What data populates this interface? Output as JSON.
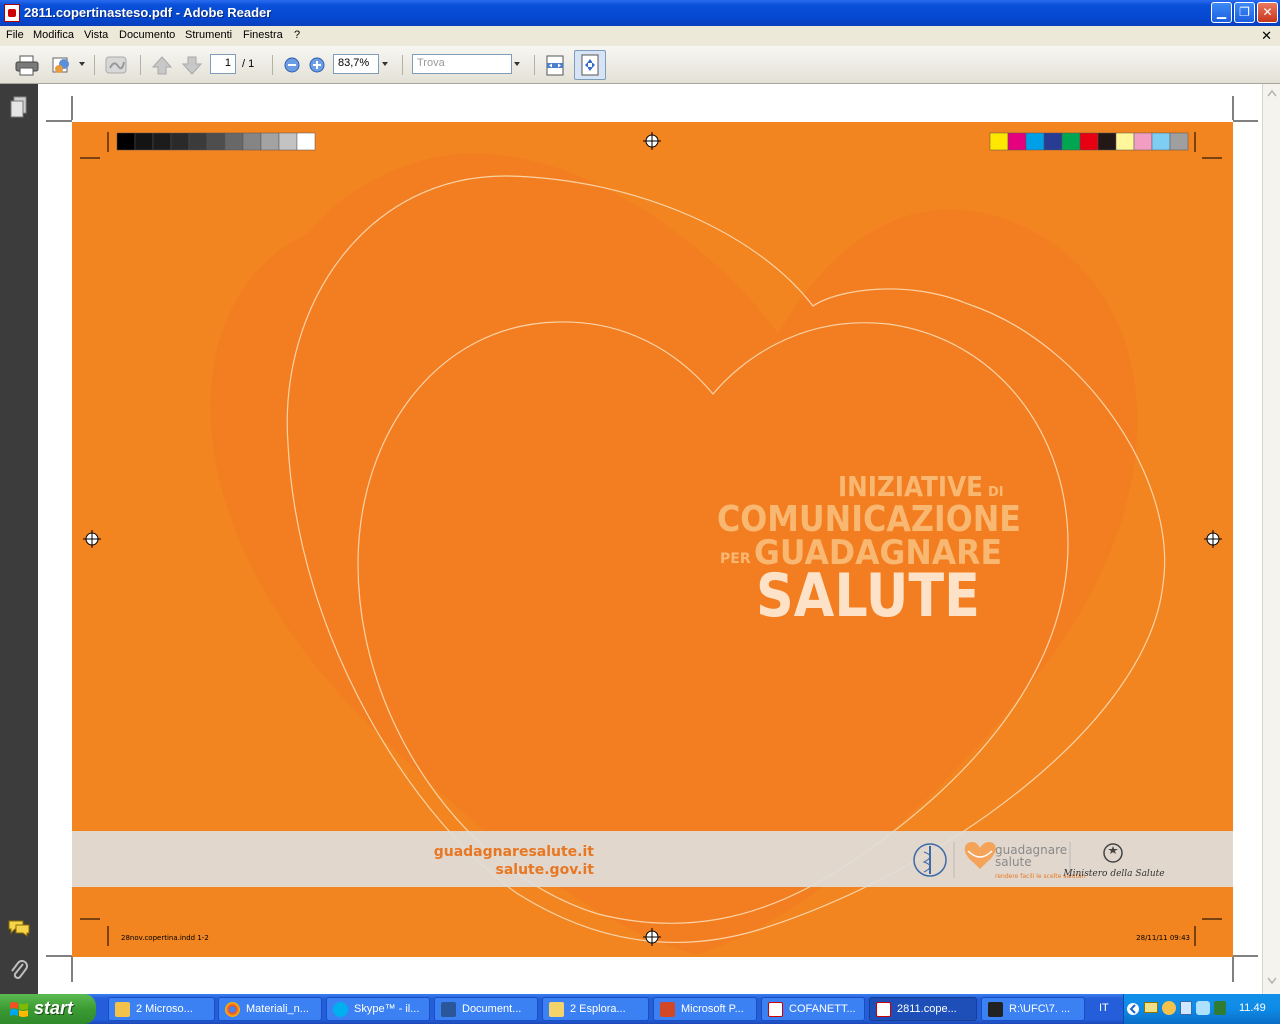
{
  "window": {
    "title": "2811.copertinasteso.pdf - Adobe Reader",
    "minimize_glyph": "▁",
    "restore_glyph": "❐",
    "close_glyph": "✕"
  },
  "menu": {
    "items": [
      "File",
      "Modifica",
      "Vista",
      "Documento",
      "Strumenti",
      "Finestra",
      "?"
    ],
    "close_glyph": "✕"
  },
  "toolbar": {
    "page_current": "1",
    "page_total": "/ 1",
    "zoom": "83,7%",
    "find_placeholder": "Trova"
  },
  "document": {
    "headline_line1_big": "INIZIATIVE",
    "headline_line1_small": "DI",
    "headline_line2": "COMUNICAZIONE",
    "headline_line3_small": "PER",
    "headline_line3_big": "GUADAGNARE",
    "headline_line4": "SALUTE",
    "website_1": "guadagnaresalute.it",
    "website_2": "salute.gov.it",
    "logo_gs_line1": "guadagnare",
    "logo_gs_line2": "salute",
    "logo_gs_tagline": "rendere facili le scelte salutari",
    "logo_ministero": "Ministero della Salute",
    "slug_left": "28nov.copertina.indd   1-2",
    "slug_right": "28/11/11   09:43",
    "gray_swatches": [
      "#000000",
      "#141414",
      "#1c1c1c",
      "#2a2a2a",
      "#3b3b3b",
      "#4e4e4e",
      "#686868",
      "#858585",
      "#a3a3a3",
      "#c3c3c3",
      "#ffffff"
    ],
    "color_swatches": [
      "#ffe800",
      "#e4007f",
      "#00a0e9",
      "#283c94",
      "#00a651",
      "#e60012",
      "#231815",
      "#fff799",
      "#f19ec2",
      "#7ecef4",
      "#9f9f9f"
    ],
    "colors": {
      "cover_orange": "#f28520",
      "heart_orange": "#f47a22",
      "headline_light": "#f9b872",
      "headline_white": "#fde2c8",
      "website_orange": "#e87722",
      "band_gray": "#e0dedc"
    }
  },
  "taskbar": {
    "start_label": "start",
    "tasks": [
      {
        "label": "2 Microso...",
        "icon": "chrome-like-icon"
      },
      {
        "label": "Materiali_n...",
        "icon": "chrome-icon"
      },
      {
        "label": "Skype™ - il...",
        "icon": "skype-icon"
      },
      {
        "label": "Document...",
        "icon": "word-icon"
      },
      {
        "label": "2 Esplora...",
        "icon": "folder-icon"
      },
      {
        "label": "Microsoft P...",
        "icon": "powerpoint-icon"
      },
      {
        "label": "COFANETT...",
        "icon": "pdf-icon"
      },
      {
        "label": "2811.cope...",
        "icon": "pdf-icon"
      },
      {
        "label": "R:\\UFC\\7. ...",
        "icon": "7zip-icon"
      }
    ],
    "language": "IT",
    "clock": "11.49"
  }
}
